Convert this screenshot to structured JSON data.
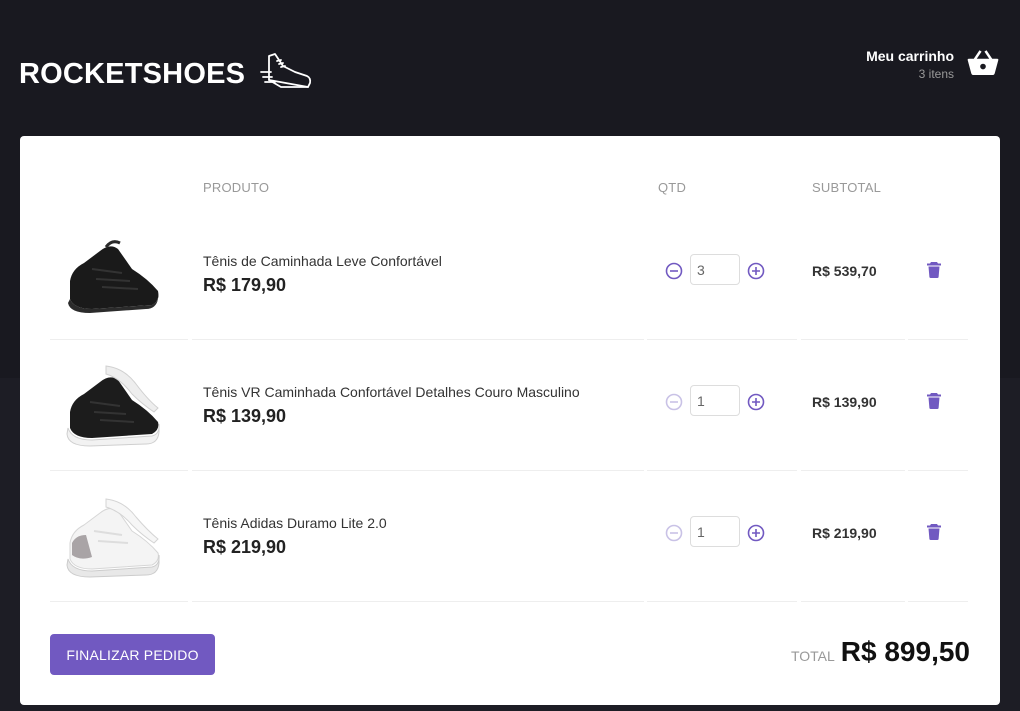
{
  "header": {
    "logo_text": "ROCKETSHOES",
    "cart_title": "Meu carrinho",
    "cart_count": "3 itens"
  },
  "table": {
    "col_product": "PRODUTO",
    "col_qty": "QTD",
    "col_subtotal": "SUBTOTAL"
  },
  "items": [
    {
      "title": "Tênis de Caminhada Leve Confortável",
      "price": "R$ 179,90",
      "qty": "3",
      "subtotal": "R$ 539,70",
      "shoe_color": "black",
      "minus_enabled": true
    },
    {
      "title": "Tênis VR Caminhada Confortável Detalhes Couro Masculino",
      "price": "R$ 139,90",
      "qty": "1",
      "subtotal": "R$ 139,90",
      "shoe_color": "black-white-sole",
      "minus_enabled": false
    },
    {
      "title": "Tênis Adidas Duramo Lite 2.0",
      "price": "R$ 219,90",
      "qty": "1",
      "subtotal": "R$ 219,90",
      "shoe_color": "white",
      "minus_enabled": false
    }
  ],
  "footer": {
    "finish_label": "FINALIZAR PEDIDO",
    "total_label": "TOTAL",
    "total_value": "R$ 899,50"
  },
  "colors": {
    "accent": "#7159c1",
    "accent_disabled": "#c9c2e6",
    "background": "#191920"
  },
  "icons": {
    "logo": "running-shoe-icon",
    "cart": "basket-icon",
    "decrement": "minus-circle-icon",
    "increment": "plus-circle-icon",
    "remove": "trash-icon"
  }
}
